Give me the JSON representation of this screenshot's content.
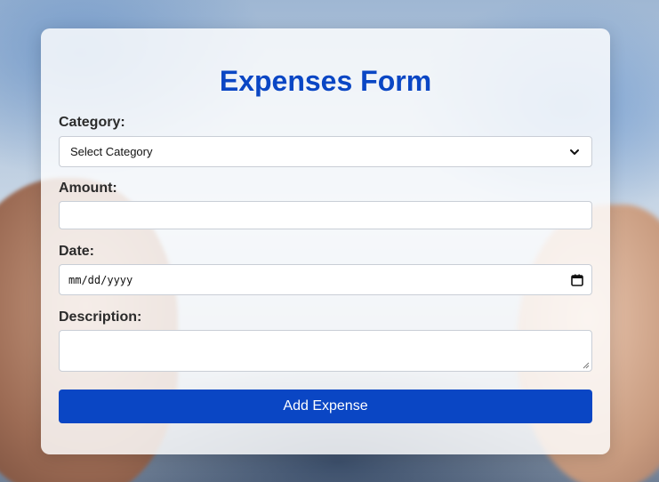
{
  "form": {
    "title": "Expenses Form",
    "category": {
      "label": "Category:",
      "selected": "Select Category"
    },
    "amount": {
      "label": "Amount:",
      "value": ""
    },
    "date": {
      "label": "Date:",
      "placeholder": "mm/dd/yyyy"
    },
    "description": {
      "label": "Description:",
      "value": ""
    },
    "submit_label": "Add Expense"
  },
  "colors": {
    "accent": "#0a46c4",
    "label_text": "#2b2b2b",
    "card_background": "rgba(255,255,255,0.82)"
  },
  "icons": {
    "select_arrow": "chevron-down-icon",
    "date_picker": "calendar-icon",
    "resize_handle": "resize-grip-icon"
  }
}
